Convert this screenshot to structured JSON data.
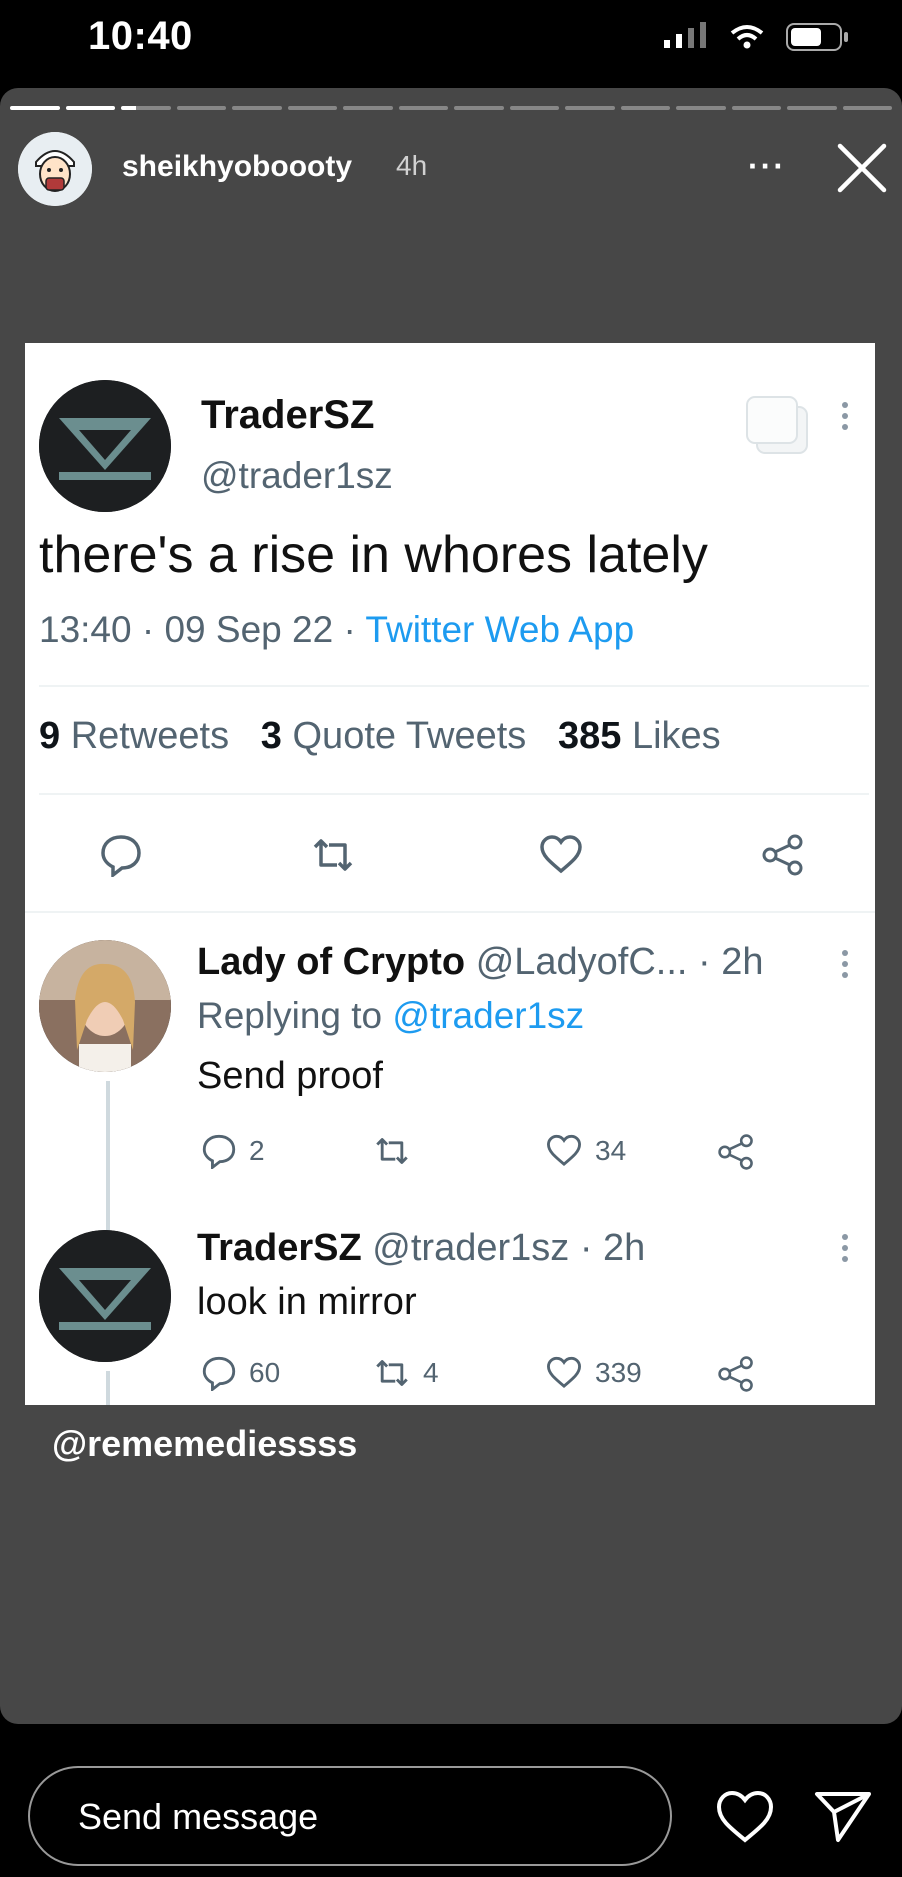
{
  "status_bar": {
    "time": "10:40"
  },
  "story": {
    "progress_segments": 16,
    "current_segment": 3,
    "username": "sheikhyoboooty",
    "posted_ago": "4h",
    "mention": "@rememediessss"
  },
  "tweet": {
    "author_name": "TraderSZ",
    "author_handle": "@trader1sz",
    "text": "there's a rise in whores lately",
    "time": "13:40",
    "date": "09 Sep 22",
    "source": "Twitter Web App",
    "retweets_count": "9",
    "retweets_label": "Retweets",
    "quotes_count": "3",
    "quotes_label": "Quote Tweets",
    "likes_count": "385",
    "likes_label": "Likes"
  },
  "replies": [
    {
      "name": "Lady of Crypto",
      "handle_time": "@LadyofC... · 2h",
      "replying_prefix": "Replying to",
      "replying_to": "@trader1sz",
      "text": "Send proof",
      "reply_count": "2",
      "retweet_count": "",
      "like_count": "34"
    },
    {
      "name": "TraderSZ",
      "handle_time": "@trader1sz · 2h",
      "text": "look in mirror",
      "reply_count": "60",
      "retweet_count": "4",
      "like_count": "339"
    }
  ],
  "footer": {
    "message_placeholder": "Send message"
  },
  "colors": {
    "story_bg": "#474747",
    "link_blue": "#1d9bf0",
    "muted_gray": "#536471"
  }
}
